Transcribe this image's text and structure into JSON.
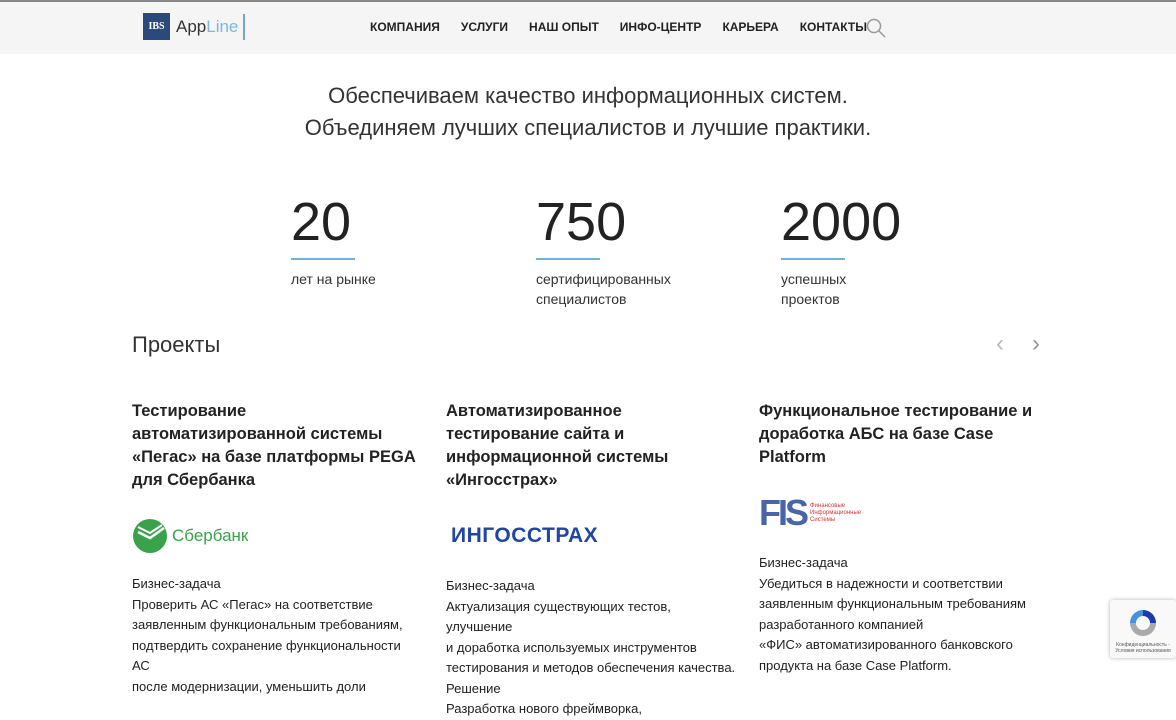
{
  "header": {
    "logo_ibs": "IBS",
    "logo_app": "App",
    "logo_line": "Line",
    "nav": [
      "КОМПАНИЯ",
      "УСЛУГИ",
      "НАШ ОПЫТ",
      "ИНФО-ЦЕНТР",
      "КАРЬЕРА",
      "КОНТАКТЫ"
    ]
  },
  "tagline": [
    "Обеспечиваем качество информационных систем.",
    "Объединяем лучших специалистов и лучшие практики."
  ],
  "stats": [
    {
      "num": "20",
      "label": [
        "лет на рынке"
      ]
    },
    {
      "num": "750",
      "label": [
        "сертифицированных",
        "специалистов"
      ]
    },
    {
      "num": "2000",
      "label": [
        "успешных",
        "проектов"
      ]
    }
  ],
  "projects": {
    "title": "Проекты",
    "prev": "‹",
    "next": "›",
    "cards": [
      {
        "title": "Тестирование автоматизированной системы «Пегас» на базе платформы PEGA для Сбербанка",
        "logo": "Сбербанк",
        "lines": [
          "Бизнес-задача",
          "Проверить АС «Пегас» на соответствие",
          "заявленным функциональным требованиям,",
          "подтвердить сохранение функциональности АС",
          "после модернизации, уменьшить доли"
        ]
      },
      {
        "title": "Автоматизированное тестирование сайта и информационной системы «Ингосстрах»",
        "logo": "ИНГОССТРАХ",
        "lines": [
          "Бизнес-задача",
          "Актуализация существующих тестов, улучшение",
          "и доработка используемых инструментов",
          "тестирования и методов обеспечения качества.",
          "Решение",
          "Разработка нового фреймворка,"
        ]
      },
      {
        "title": "Функциональное тестирование и доработка АБС на базе Case Platform",
        "logo": "FIS",
        "logo_sub": "Финансовые Информационные Системы",
        "lines": [
          "Бизнес-задача",
          "Убедиться в надежности и соответствии",
          "заявленным функциональным требованиям",
          "разработанного компанией",
          "«ФИС» автоматизированного банковского",
          "продукта на базе Case Platform."
        ]
      }
    ]
  },
  "recaptcha": "Конфиденциальность - Условия использования"
}
